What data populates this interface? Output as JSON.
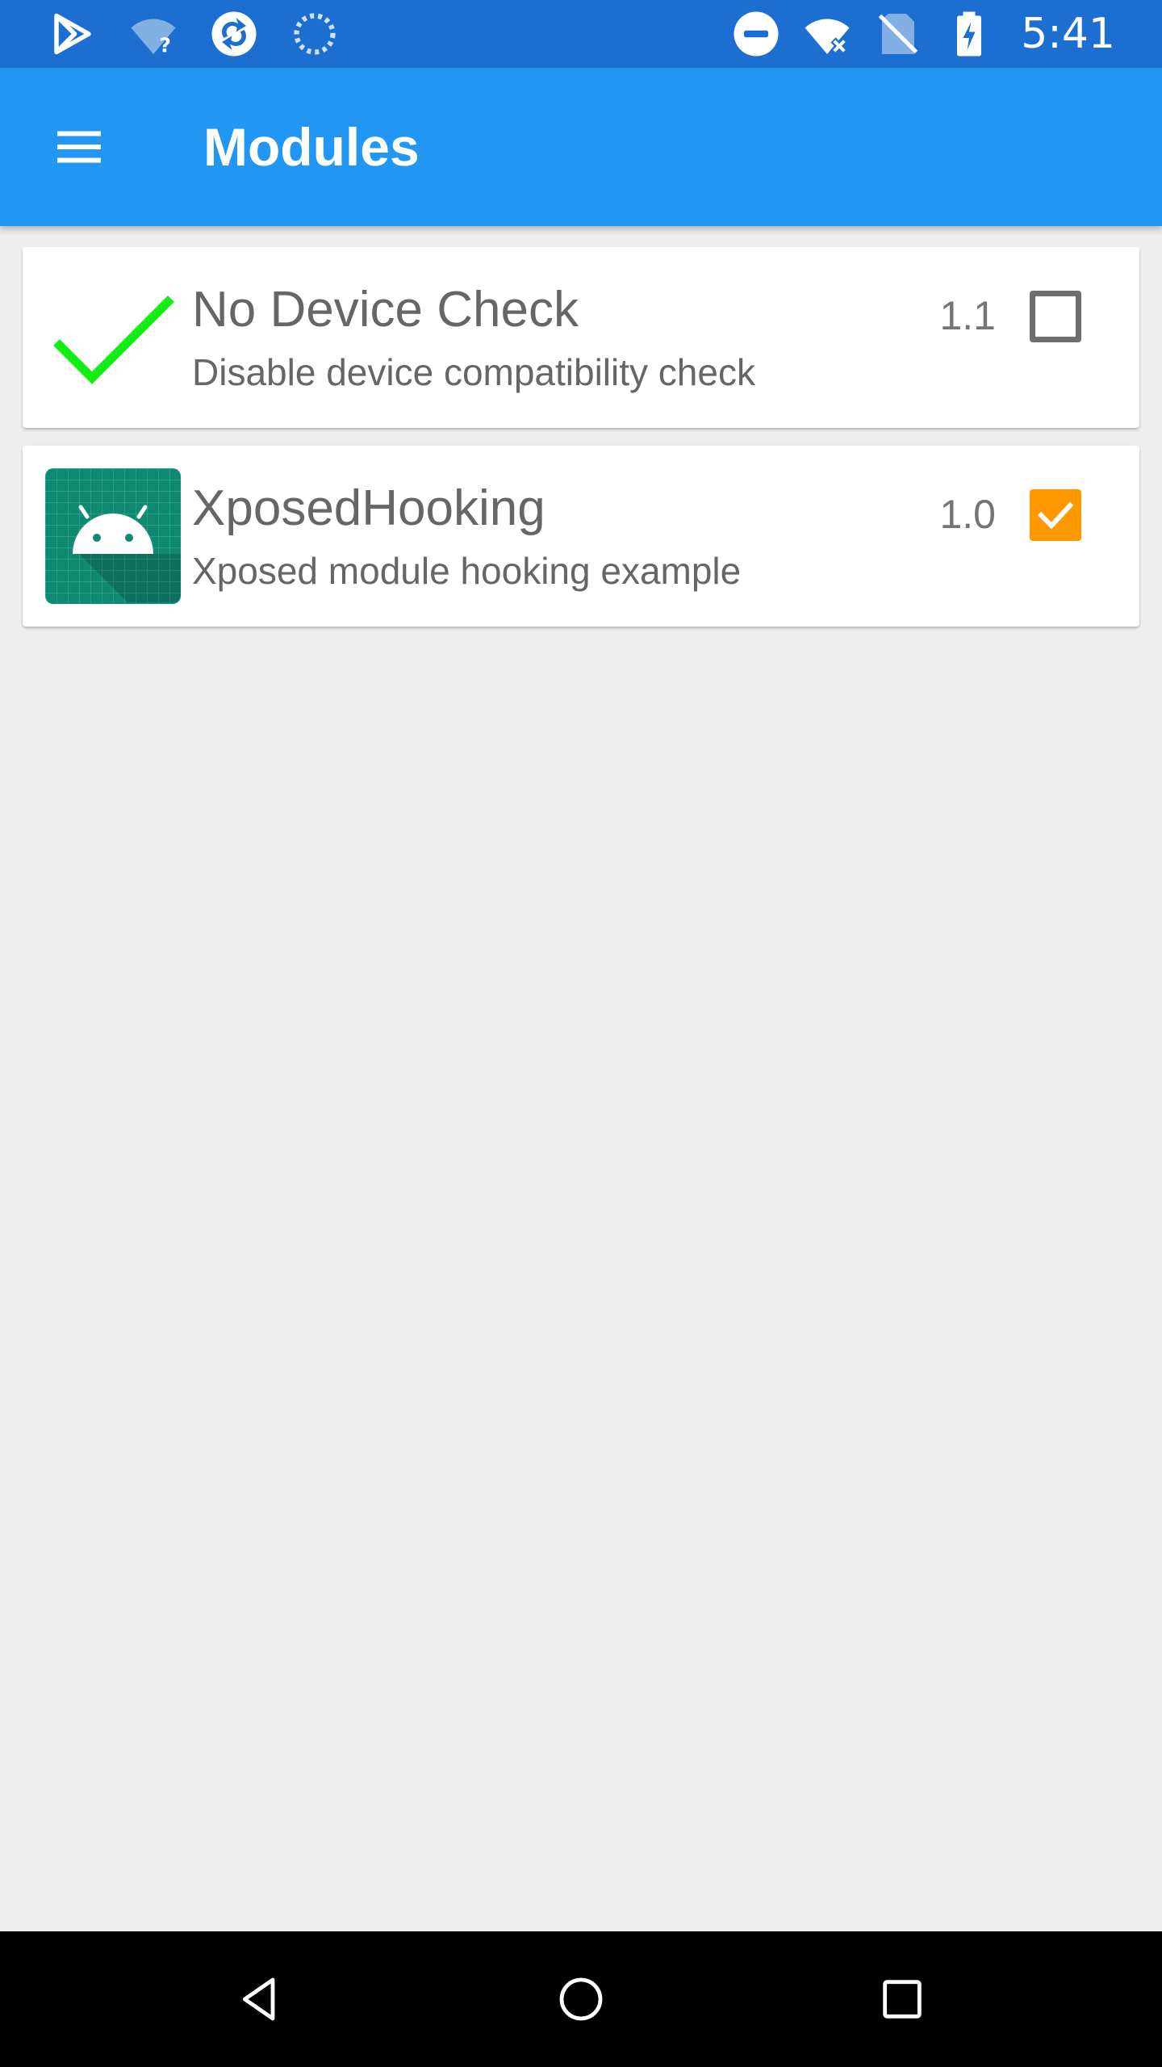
{
  "status_bar": {
    "time": "5:41",
    "icons_left": [
      "play-store-icon",
      "wifi-unknown-icon",
      "sync-icon",
      "loading-icon"
    ],
    "icons_right": [
      "do-not-disturb-icon",
      "wifi-off-icon",
      "no-sim-icon",
      "battery-charging-icon"
    ]
  },
  "app_bar": {
    "title": "Modules",
    "menu_icon": "hamburger-menu-icon",
    "color": "#2196f3"
  },
  "modules": [
    {
      "icon": "green-checkmark-icon",
      "title": "No Device Check",
      "description": "Disable device compatibility check",
      "version": "1.1",
      "enabled": false
    },
    {
      "icon": "android-robot-icon",
      "title": "XposedHooking",
      "description": "Xposed module hooking example",
      "version": "1.0",
      "enabled": true
    }
  ],
  "nav_bar": {
    "back_icon": "back-triangle-icon",
    "home_icon": "home-circle-icon",
    "recents_icon": "recents-square-icon"
  },
  "colors": {
    "status_bar": "#1c6fd0",
    "accent": "#ff9800",
    "background": "#eeeeee"
  }
}
